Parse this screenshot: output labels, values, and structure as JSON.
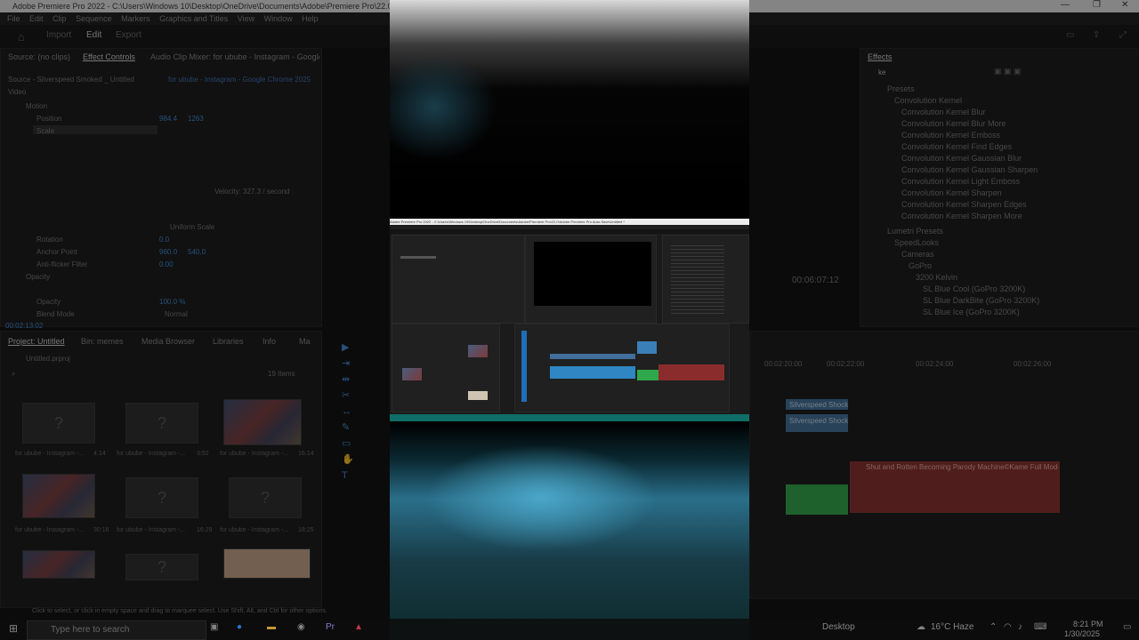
{
  "window": {
    "title": "Adobe Premiere Pro 2022 - C:\\Users\\Windows 10\\Desktop\\OneDrive\\Documents\\Adobe\\Premiere Pro\\22.0\\Adobe Premiere Pro Auto-Save\\Untitled *",
    "controls": [
      "—",
      "❐",
      "✕"
    ]
  },
  "menu": [
    "File",
    "Edit",
    "Clip",
    "Sequence",
    "Markers",
    "Graphics and Titles",
    "View",
    "Window",
    "Help"
  ],
  "workspace": {
    "tabs": [
      "Import",
      "Edit",
      "Export"
    ],
    "active": "Edit"
  },
  "effect_controls": {
    "tabs": [
      "Source: (no clips)",
      "Effect Controls",
      "Audio Clip Mixer: for ubube - Instagram - Google Chrome 2025-01-29 11-34-08"
    ],
    "clip_name": "Source - Silverspeed Smoked _ Untitled",
    "sequence_clip": "for ubube - Instagram - Google Chrome 2025...",
    "sections": [
      "Video",
      "Motion",
      "Position",
      "Scale",
      "Uniform Scale",
      "Rotation",
      "Anchor Point",
      "Anti-flicker Filter",
      "Opacity",
      "Blend Mode"
    ],
    "position_values": [
      "984.4",
      "1263"
    ],
    "rotation": "0.0",
    "anchor_values": [
      "960.0",
      "540.0"
    ],
    "anti_flicker": "0.00",
    "opacity_value": "100.0 %",
    "blend_mode": "Normal",
    "velocity": "Velocity: 327.3 / second",
    "timecode": "00:02:13:02"
  },
  "project": {
    "tabs": [
      "Project: Untitled",
      "Bin: memes",
      "Media Browser",
      "Libraries",
      "Info",
      "Ma"
    ],
    "folder": "Untitled.prproj",
    "item_count": "19 Items",
    "items": [
      {
        "label": "for ubube - Instagram -...",
        "duration": "4:14",
        "type": "missing"
      },
      {
        "label": "for ubube - Instagram -...",
        "duration": "3:52",
        "type": "missing"
      },
      {
        "label": "for ubube - Instagram -...",
        "duration": "16:14",
        "type": "image"
      },
      {
        "label": "for ubube - Instagram -...",
        "duration": "30:16",
        "type": "image"
      },
      {
        "label": "for ubube - Instagram -...",
        "duration": "16:29",
        "type": "missing"
      },
      {
        "label": "for ubube - Instagram -...",
        "duration": "18:25",
        "type": "missing"
      },
      {
        "label": "",
        "duration": "",
        "type": "image"
      },
      {
        "label": "",
        "duration": "",
        "type": "missing"
      },
      {
        "label": "",
        "duration": "",
        "type": "image"
      }
    ]
  },
  "effects": {
    "title": "Effects",
    "search_value": "ke",
    "items": [
      "Presets",
      "Convolution Kernel",
      "Convolution Kernel Blur",
      "Convolution Kernel Blur More",
      "Convolution Kernel Emboss",
      "Convolution Kernel Find Edges",
      "Convolution Kernel Gaussian Blur",
      "Convolution Kernel Gaussian Sharpen",
      "Convolution Kernel Light Emboss",
      "Convolution Kernel Sharpen",
      "Convolution Kernel Sharpen Edges",
      "Convolution Kernel Sharpen More",
      "Lumetri Presets",
      "SpeedLooks",
      "Cameras",
      "GoPro",
      "3200 Kelvin",
      "SL Blue Cool (GoPro 3200K)",
      "SL Blue DarkBite (GoPro 3200K)",
      "SL Blue Ice (GoPro 3200K)"
    ]
  },
  "program": {
    "timecode": "00:06:07:12"
  },
  "timeline": {
    "ticks": [
      "00:02:20:00",
      "00:02:22:00",
      "00:02:24:00",
      "00:02:26:00"
    ],
    "clips": [
      {
        "label": "Silverspeed Shock",
        "color": "#3f6f9a"
      },
      {
        "label": "Silverspeed Shock",
        "color": "#3f6f9a"
      },
      {
        "label": "Shut and Rotten Becoming Parody Machine©Kame Full Mode 9 - YouTube",
        "color": "#8a2c2c"
      }
    ],
    "hint": "Click to select, or click in empty space and drag to marquee select. Use Shift, Alt, and Ctrl for other options."
  },
  "taskbar": {
    "search_placeholder": "Type here to search",
    "desktop_label": "Desktop",
    "weather": "16°C Haze",
    "time": "8:21 PM",
    "date": "1/30/2025"
  },
  "colors": {
    "accent_blue": "#2d8ceb",
    "video_teal": "#0f6e67"
  }
}
